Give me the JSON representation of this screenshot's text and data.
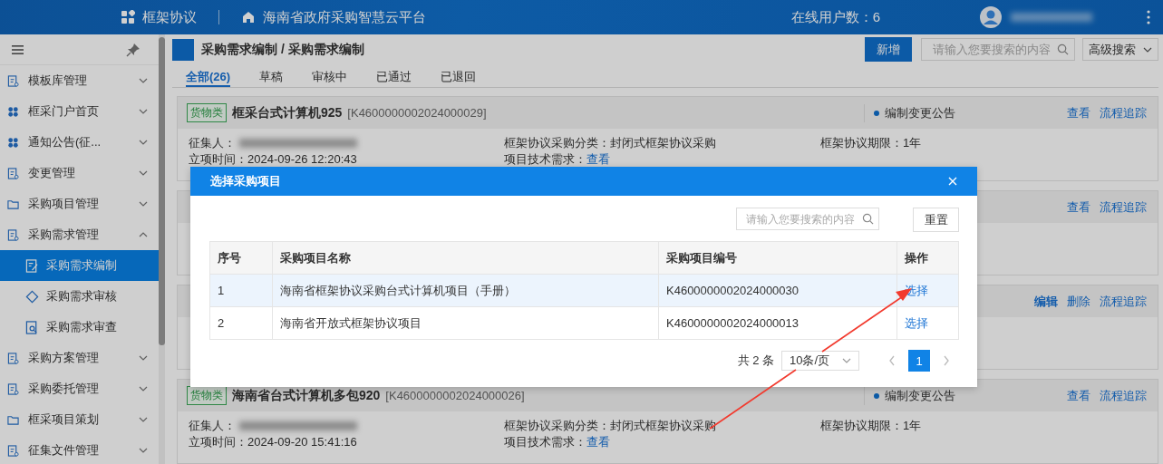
{
  "header": {
    "app_name": "框架协议",
    "platform": "海南省政府采购智慧云平台",
    "online_users": "在线用户数：6"
  },
  "sidebar": {
    "items": [
      {
        "label": "模板库管理",
        "expanded": false
      },
      {
        "label": "框采门户首页",
        "expanded": false
      },
      {
        "label": "通知公告(征...",
        "expanded": false
      },
      {
        "label": "变更管理",
        "expanded": false
      },
      {
        "label": "采购项目管理",
        "expanded": false
      },
      {
        "label": "采购需求管理",
        "expanded": true,
        "children": [
          {
            "label": "采购需求编制",
            "selected": true
          },
          {
            "label": "采购需求审核",
            "selected": false
          },
          {
            "label": "采购需求审查",
            "selected": false
          }
        ]
      },
      {
        "label": "采购方案管理",
        "expanded": false
      },
      {
        "label": "采购委托管理",
        "expanded": false
      },
      {
        "label": "框采项目策划",
        "expanded": false
      },
      {
        "label": "征集文件管理",
        "expanded": false
      }
    ]
  },
  "page": {
    "title": "采购需求编制 / 采购需求编制",
    "add_button": "新增",
    "search": {
      "placeholder": "请输入您要搜索的内容"
    },
    "advanced_search": "高级搜索"
  },
  "tabs": [
    {
      "label": "全部(26)",
      "selected": true
    },
    {
      "label": "草稿",
      "selected": false
    },
    {
      "label": "审核中",
      "selected": false
    },
    {
      "label": "已通过",
      "selected": false
    },
    {
      "label": "已退回",
      "selected": false
    }
  ],
  "cards": [
    {
      "tag": "货物类",
      "title": "框采台式计算机925",
      "code": "[K4600000002024000029]",
      "status": "编制变更公告",
      "actions": [
        {
          "label": "查看",
          "bold": false
        },
        {
          "label": "流程追踪",
          "bold": false
        }
      ],
      "fields": [
        {
          "kind": "redacted",
          "label": "征集人："
        },
        {
          "kind": "text",
          "label": "框架协议采购分类：",
          "value": "封闭式框架协议采购"
        },
        {
          "kind": "text",
          "label": "框架协议期限：",
          "value": "1年"
        },
        {
          "kind": "text",
          "label": "立项时间：",
          "value": "2024-09-26 12:20:43"
        },
        {
          "kind": "link",
          "label": "项目技术需求：",
          "value": "查看"
        }
      ]
    },
    {
      "actions": [
        {
          "label": "查看",
          "bold": false
        },
        {
          "label": "流程追踪",
          "bold": false
        }
      ]
    },
    {
      "actions": [
        {
          "label": "编辑",
          "bold": true
        },
        {
          "label": "删除",
          "bold": false
        },
        {
          "label": "流程追踪",
          "bold": false
        }
      ]
    },
    {
      "tag": "货物类",
      "title": "海南省台式计算机多包920",
      "code": "[K4600000002024000026]",
      "status": "编制变更公告",
      "actions": [
        {
          "label": "查看",
          "bold": false
        },
        {
          "label": "流程追踪",
          "bold": false
        }
      ],
      "fields": [
        {
          "kind": "redacted",
          "label": "征集人："
        },
        {
          "kind": "text",
          "label": "框架协议采购分类：",
          "value": "封闭式框架协议采购"
        },
        {
          "kind": "text",
          "label": "框架协议期限：",
          "value": "1年"
        },
        {
          "kind": "text",
          "label": "立项时间：",
          "value": "2024-09-20 15:41:16"
        },
        {
          "kind": "link",
          "label": "项目技术需求：",
          "value": "查看"
        }
      ]
    }
  ],
  "modal": {
    "title": "选择采购项目",
    "search": {
      "placeholder": "请输入您要搜索的内容"
    },
    "reset_button": "重置",
    "table": {
      "columns": [
        "序号",
        "采购项目名称",
        "采购项目编号",
        "操作"
      ],
      "rows": [
        {
          "cells": [
            "1",
            "海南省框架协议采购台式计算机项目（手册）",
            "K4600000002024000030"
          ],
          "action": "选择",
          "highlighted": true
        },
        {
          "cells": [
            "2",
            "海南省开放式框架协议项目",
            "K4600000002024000013"
          ],
          "action": "选择",
          "highlighted": false
        }
      ]
    },
    "pagination": {
      "total": "共 2 条",
      "page_size": "10条/页",
      "pages": [
        {
          "label": "1",
          "selected": true
        }
      ]
    }
  }
}
